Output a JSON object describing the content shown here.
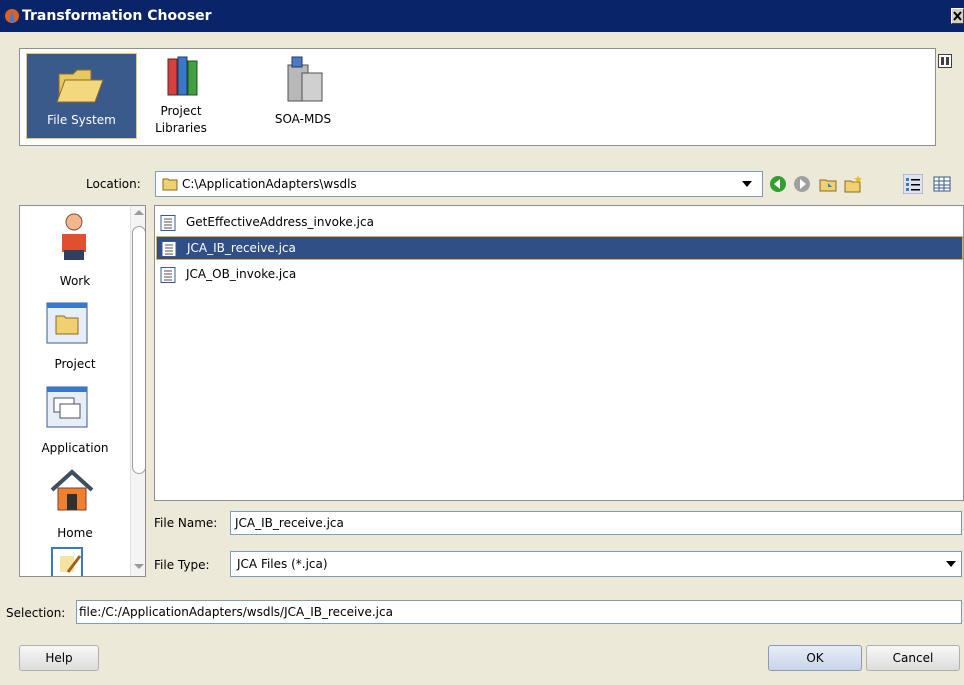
{
  "window": {
    "title": "Transformation Chooser"
  },
  "sources": {
    "items": [
      {
        "label": "File System",
        "selected": true
      },
      {
        "label": "Project\nLibraries",
        "selected": false
      },
      {
        "label": "SOA-MDS",
        "selected": false
      }
    ]
  },
  "location": {
    "label": "Location:",
    "value": "C:\\ApplicationAdapters\\wsdls"
  },
  "toolbar": {
    "icons": [
      "back-icon",
      "forward-icon",
      "up-folder-icon",
      "new-folder-icon",
      "list-view-icon",
      "details-view-icon"
    ]
  },
  "shortcuts": {
    "items": [
      {
        "label": "Work",
        "icon": "user-icon"
      },
      {
        "label": "Project",
        "icon": "project-icon"
      },
      {
        "label": "Application",
        "icon": "application-icon"
      },
      {
        "label": "Home",
        "icon": "home-icon"
      },
      {
        "label": "",
        "icon": "document-edit-icon"
      }
    ]
  },
  "files": [
    {
      "name": "GetEffectiveAddress_invoke.jca",
      "selected": false
    },
    {
      "name": "JCA_IB_receive.jca",
      "selected": true
    },
    {
      "name": "JCA_OB_invoke.jca",
      "selected": false
    }
  ],
  "file_name": {
    "label": "File Name:",
    "value": "JCA_IB_receive.jca"
  },
  "file_type": {
    "label": "File Type:",
    "value": "JCA Files (*.jca)"
  },
  "selection": {
    "label": "Selection:",
    "value": "file:/C:/ApplicationAdapters/wsdls/JCA_IB_receive.jca"
  },
  "buttons": {
    "help": "Help",
    "ok": "OK",
    "cancel": "Cancel"
  },
  "colors": {
    "titlebar": "#0a246a",
    "selection": "#2f4f86",
    "dialog_bg": "#ece9d8"
  }
}
